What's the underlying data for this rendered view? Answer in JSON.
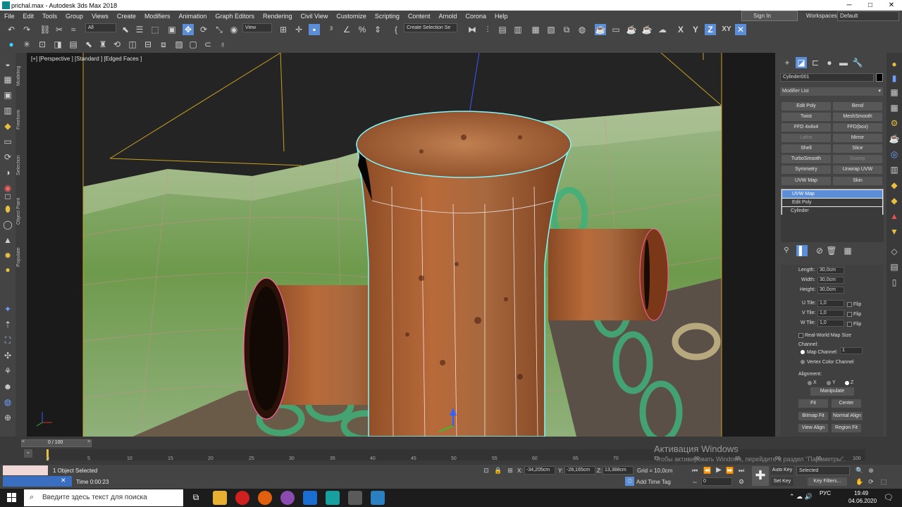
{
  "title": "prichal.max - Autodesk 3ds Max 2018",
  "window_controls": [
    "─",
    "□",
    "✕"
  ],
  "menu": [
    "File",
    "Edit",
    "Tools",
    "Group",
    "Views",
    "Create",
    "Modifiers",
    "Animation",
    "Graph Editors",
    "Rendering",
    "Civil View",
    "Customize",
    "Scripting",
    "Content",
    "Arnold",
    "Corona",
    "Help"
  ],
  "signin": "Sign In",
  "workspaces_label": "Workspaces:",
  "workspaces_value": "Default",
  "toolbar": {
    "filter": "All",
    "view": "View",
    "selset": "Create Selection Se",
    "axes": [
      "X",
      "Y",
      "Z",
      "XY"
    ]
  },
  "viewport": {
    "label": "[+] [Perspective ] [Standard ] [Edged Faces ]"
  },
  "left_tabs": [
    "Modeling",
    "Freeform",
    "Selection",
    "Object Paint",
    "Populate"
  ],
  "cmd": {
    "object_name": "Cylinder001",
    "modifier_list": "Modifier List",
    "mod_buttons": [
      [
        "Edit Poly",
        "Bend"
      ],
      [
        "Twist",
        "MeshSmooth"
      ],
      [
        "FFD 4x4x4",
        "FFD(box)"
      ],
      [
        "Lathe",
        "Mirror"
      ],
      [
        "Shell",
        "Slice"
      ],
      [
        "TurboSmooth",
        "Sweep"
      ],
      [
        "Symmetry",
        "Unwrap UVW"
      ],
      [
        "UVW Map",
        "Skin"
      ]
    ],
    "stack": [
      "UVW Map",
      "Edit Poly",
      "Cylinder"
    ],
    "params": {
      "length_label": "Length:",
      "length": "30,0cm",
      "width_label": "Width:",
      "width": "30,0cm",
      "height_label": "Height:",
      "height": "30,0cm",
      "utile_label": "U Tile:",
      "utile": "1,0",
      "vtile_label": "V Tile:",
      "vtile": "1,0",
      "wtile_label": "W Tile:",
      "wtile": "1,0",
      "flip": "Flip",
      "realworld": "Real-World Map Size",
      "channel_label": "Channel:",
      "map_channel_label": "Map Channel:",
      "map_channel": "1",
      "vertex_color": "Vertex Color Channel",
      "alignment_label": "Alignment:",
      "ax": [
        "X",
        "Y",
        "Z"
      ],
      "manipulate": "Manipulate",
      "fit": "Fit",
      "center": "Center",
      "bitmap_fit": "Bitmap Fit",
      "normal_align": "Normal Align",
      "view_align": "View Align",
      "region_fit": "Region Fit"
    }
  },
  "timeline": {
    "frame": "0 / 100",
    "ticks": [
      "0",
      "5",
      "10",
      "15",
      "20",
      "25",
      "30",
      "35",
      "40",
      "45",
      "50",
      "55",
      "60",
      "65",
      "70",
      "75",
      "80",
      "85",
      "90",
      "95",
      "100"
    ]
  },
  "status": {
    "selected": "1 Object Selected",
    "time": "Time 0:00:23",
    "x_label": "X:",
    "x": "-34,205cm",
    "y_label": "Y:",
    "y": "-28,165cm",
    "z_label": "Z:",
    "z": "13,388cm",
    "grid": "Grid = 10,0cm",
    "add_time_tag": "Add Time Tag",
    "autokey": "Auto Key",
    "setkey": "Set Key",
    "selected_dd": "Selected",
    "key_filters": "Key Filters...",
    "frame_spin": "0"
  },
  "watermark": {
    "line1": "Активация Windows",
    "line2": "Чтобы активировать Windows, перейдите в раздел \"Параметры\"."
  },
  "taskbar": {
    "search": "Введите здесь текст для поиска",
    "clock": "19:49",
    "date": "04.06.2020",
    "lang": "РУС"
  }
}
